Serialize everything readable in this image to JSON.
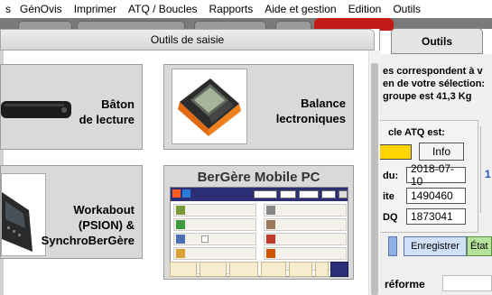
{
  "menubar": {
    "items": [
      "s",
      "GénOvis",
      "Imprimer",
      "ATQ / Boucles",
      "Rapports",
      "Aide et gestion",
      "Edition",
      "Outils"
    ]
  },
  "popup": {
    "title": "Outils de saisie",
    "tiles": [
      {
        "label_line1": "Bâton",
        "label_line2": "de lecture"
      },
      {
        "label_line1": "Balance",
        "label_line2": "lectroniques"
      },
      {
        "label_line1": "Workabout",
        "label_line2": "(PSION) &",
        "label_line3": "SynchroBerGère"
      },
      {
        "title": "BerGère Mobile PC"
      }
    ]
  },
  "background_app": {
    "outils_label": "Outils",
    "info_lines": [
      "es correspondent à v",
      "en de votre sélection:",
      "groupe est 41,3 Kg"
    ],
    "atq_title": "cle ATQ est:",
    "info_button": "Info",
    "fields": [
      {
        "label": "du:",
        "value": "2018-07-10"
      },
      {
        "label": "ite",
        "value": "1490460"
      },
      {
        "label": "DQ",
        "value": "1873041"
      }
    ],
    "side_number": "1",
    "tabs": {
      "enregistrer": "Enregistrer",
      "etat": "État"
    },
    "reforme_label": "réforme"
  },
  "colors": {
    "accent_red": "#c21b17",
    "status_yellow": "#ffd400",
    "tab_green": "#b5e39c",
    "tab_blue": "#cfe0f8",
    "bergere_header": "#2c2f75"
  }
}
